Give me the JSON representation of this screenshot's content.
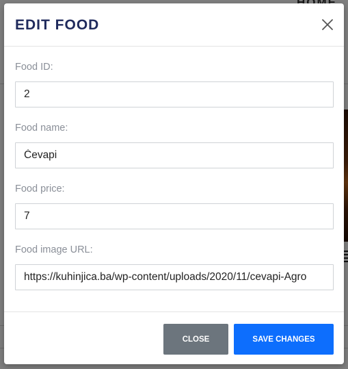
{
  "background": {
    "nav_text": "HOME"
  },
  "modal": {
    "title": "EDIT FOOD",
    "fields": [
      {
        "label": "Food ID:",
        "value": "2"
      },
      {
        "label": "Food name:",
        "value": "Ćevapi"
      },
      {
        "label": "Food price:",
        "value": "7"
      },
      {
        "label": "Food image URL:",
        "value": "https://kuhinjica.ba/wp-content/uploads/2020/11/cevapi-Agro"
      }
    ],
    "buttons": {
      "close": "CLOSE",
      "save": "SAVE CHANGES"
    }
  },
  "colors": {
    "title": "#1f2a5c",
    "close_button": "#6c757d",
    "save_button": "#0d6efd"
  },
  "icons": {
    "close": "close-icon"
  }
}
